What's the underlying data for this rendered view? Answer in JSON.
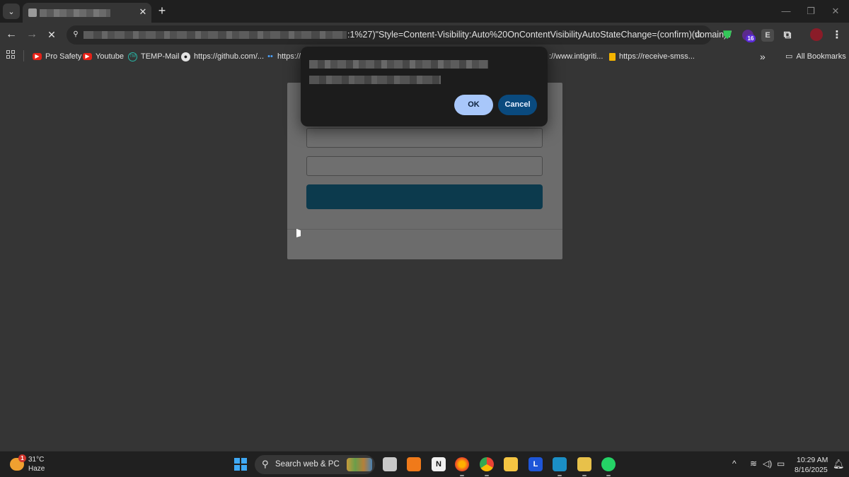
{
  "browser": {
    "tab": {
      "close_glyph": "✕"
    },
    "new_tab_glyph": "+",
    "tab_search_glyph": "⌄",
    "window_controls": {
      "minimize": "—",
      "restore": "❐",
      "close": "✕"
    },
    "nav": {
      "back": "←",
      "forward": "→",
      "stop": "✕"
    },
    "address_bar": {
      "url_visible": ":1%27)\"Style=Content-Visibility:Auto%20OnContentVisibilityAutoStateChange=(confirm)(domain)//",
      "site_icon": "⚲",
      "bookmark_star": "☆"
    },
    "extensions": {
      "shield_glyph": "⛊",
      "badge_count": "16",
      "e_label": "E",
      "puzzle_glyph": "⧉",
      "menu_glyph": "⋮"
    }
  },
  "bookmarks": {
    "items": [
      {
        "label": "Pro Safety",
        "icon": "youtube-icon"
      },
      {
        "label": "Youtube",
        "icon": "youtube-icon"
      },
      {
        "label": "TEMP-Mail",
        "icon": "temp-mail-icon"
      },
      {
        "label": "https://github.com/...",
        "icon": "github-icon"
      },
      {
        "label": "https://",
        "icon": "dots-icon"
      },
      {
        "label": "://www.intigriti...",
        "icon": ""
      },
      {
        "label": "https://receive-smss...",
        "icon": "flag-icon"
      }
    ],
    "overflow_glyph": "»",
    "all_bookmarks": "All Bookmarks",
    "folder_glyph": "▭"
  },
  "dialog": {
    "ok_label": "OK",
    "cancel_label": "Cancel"
  },
  "taskbar": {
    "weather": {
      "badge": "1",
      "temp": "31°C",
      "desc": "Haze"
    },
    "search_placeholder": "Search web & PC",
    "search_glyph": "⚲",
    "notion_label": "N",
    "l_label": "L",
    "tray": {
      "chevron": "^",
      "wifi": "≋",
      "volume": "◁)",
      "battery": "▭"
    },
    "clock": {
      "time": "10:29 AM",
      "date": "8/16/2025"
    },
    "notification_glyph": "🔔︎"
  },
  "colors": {
    "page_bg": "#353535",
    "card_bg": "#6c6c6c",
    "submit_button": "#0c3a4d",
    "dialog_bg": "#1c1c1c",
    "ok_button": "#a8c7fa",
    "cancel_button": "#0a4a7e"
  }
}
